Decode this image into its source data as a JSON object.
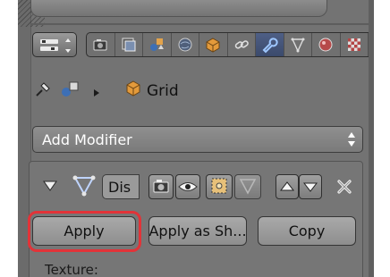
{
  "breadcrumb": {
    "object_name": "Grid"
  },
  "add_modifier": {
    "label": "Add Modifier"
  },
  "modifier": {
    "name_value": "Dis",
    "buttons": {
      "apply": "Apply",
      "apply_as_shape": "Apply as Sh...",
      "copy": "Copy"
    },
    "texture_label": "Texture:"
  },
  "colors": {
    "highlight": "#e23338",
    "active_tab": "#3b4a6c",
    "panel_bg": "#737373"
  },
  "tabs": [
    {
      "icon": "camera-icon"
    },
    {
      "icon": "render-layers-icon"
    },
    {
      "icon": "scene-icon"
    },
    {
      "icon": "world-icon"
    },
    {
      "icon": "object-icon"
    },
    {
      "icon": "constraints-icon"
    },
    {
      "icon": "modifiers-wrench-icon",
      "active": true
    },
    {
      "icon": "mesh-data-icon"
    },
    {
      "icon": "material-icon"
    },
    {
      "icon": "texture-icon"
    }
  ]
}
